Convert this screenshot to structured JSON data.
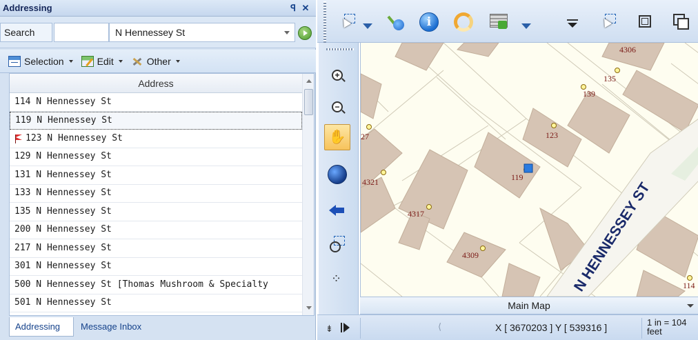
{
  "panel": {
    "title": "Addressing",
    "pin_glyph": "ꟼ",
    "close_glyph": "✕"
  },
  "search": {
    "label": "Search",
    "input_value": "",
    "street_value": "N Hennessey St"
  },
  "toolbar": {
    "selection_label": "Selection",
    "edit_label": "Edit",
    "other_label": "Other"
  },
  "table": {
    "column_header": "Address",
    "rows": [
      {
        "address": "114 N Hennessey St"
      },
      {
        "address": "119 N Hennessey St",
        "selected": true
      },
      {
        "address": "123 N Hennessey St",
        "flagged": true
      },
      {
        "address": "129 N Hennessey St"
      },
      {
        "address": "131 N Hennessey St"
      },
      {
        "address": "133 N Hennessey St"
      },
      {
        "address": "135 N Hennessey St"
      },
      {
        "address": "200 N Hennessey St"
      },
      {
        "address": "217 N Hennessey St"
      },
      {
        "address": "301 N Hennessey St"
      },
      {
        "address": "500 N Hennessey St [Thomas Mushroom & Specialty"
      },
      {
        "address": "501 N Hennessey St"
      }
    ]
  },
  "bottom_tabs": {
    "addressing": "Addressing",
    "inbox": "Message Inbox"
  },
  "map": {
    "title": "Main Map",
    "street_label": "N HENNESSEY ST",
    "parcel_labels": [
      {
        "text": "4306"
      },
      {
        "text": "135"
      },
      {
        "text": "139"
      },
      {
        "text": "27"
      },
      {
        "text": "123"
      },
      {
        "text": "4321"
      },
      {
        "text": "119"
      },
      {
        "text": "4317"
      },
      {
        "text": "4309"
      },
      {
        "text": "114"
      }
    ],
    "colors": {
      "background": "#fefdf0",
      "parcel_fill": "#d6c4b4",
      "parcel_line": "#c9c2b0",
      "label": "#7a1a16",
      "marker": "#2a7be0",
      "street_text": "#1a2a6a"
    }
  },
  "status": {
    "coords": "X [ 3670203 ]   Y [ 539316 ]",
    "scale_line1": "1 in = 104",
    "scale_line2": "feet"
  },
  "colors": {
    "panel_bg": "#d5e2f2",
    "title_text": "#15428b",
    "active_tool": "#f7c35c"
  }
}
